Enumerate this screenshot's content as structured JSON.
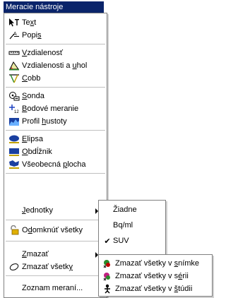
{
  "menubar": {
    "title": "Meracie nástroje"
  },
  "menu": {
    "items": [
      {
        "label_pre": "",
        "label_u": "",
        "label_post": "Text"
      },
      {
        "label_pre": "",
        "label_u": "",
        "label_post": "Popis"
      },
      {
        "label_pre": "",
        "label_u": "",
        "label_post": "Vzdialenosť"
      },
      {
        "label_pre": "",
        "label_u": "",
        "label_post": "Vzdialenosti a uhol"
      },
      {
        "label_pre": "",
        "label_u": "",
        "label_post": "Cobb"
      },
      {
        "label_pre": "",
        "label_u": "",
        "label_post": "Sonda"
      },
      {
        "label_pre": "",
        "label_u": "",
        "label_post": "Bodové meranie"
      },
      {
        "label_pre": "",
        "label_u": "",
        "label_post": "Profil hustoty"
      },
      {
        "label_pre": "",
        "label_u": "",
        "label_post": "Elipsa"
      },
      {
        "label_pre": "",
        "label_u": "",
        "label_post": "Obdĺžnik"
      },
      {
        "label_pre": "",
        "label_u": "",
        "label_post": "Všeobecná plocha"
      },
      {
        "label_pre": "",
        "label_u": "",
        "label_post": "Jednotky"
      },
      {
        "label_pre": "",
        "label_u": "",
        "label_post": "Odomknúť všetky"
      },
      {
        "label_pre": "",
        "label_u": "",
        "label_post": "Zmazať"
      },
      {
        "label_pre": "",
        "label_u": "",
        "label_post": "Zmazať všetky"
      },
      {
        "label_pre": "",
        "label_u": "",
        "label_post": "Zoznam meraní..."
      }
    ]
  },
  "units_submenu": {
    "items": [
      {
        "label": "Žiadne",
        "checked": false
      },
      {
        "label": "Bq/ml",
        "checked": false
      },
      {
        "label": "SUV",
        "checked": true
      }
    ]
  },
  "delete_submenu": {
    "items": [
      {
        "label": "Zmazať všetky v snímke"
      },
      {
        "label": "Zmazať všetky v sérii"
      },
      {
        "label": "Zmazať všetky v štúdii"
      }
    ]
  },
  "glyphs": {
    "check": "✔"
  }
}
